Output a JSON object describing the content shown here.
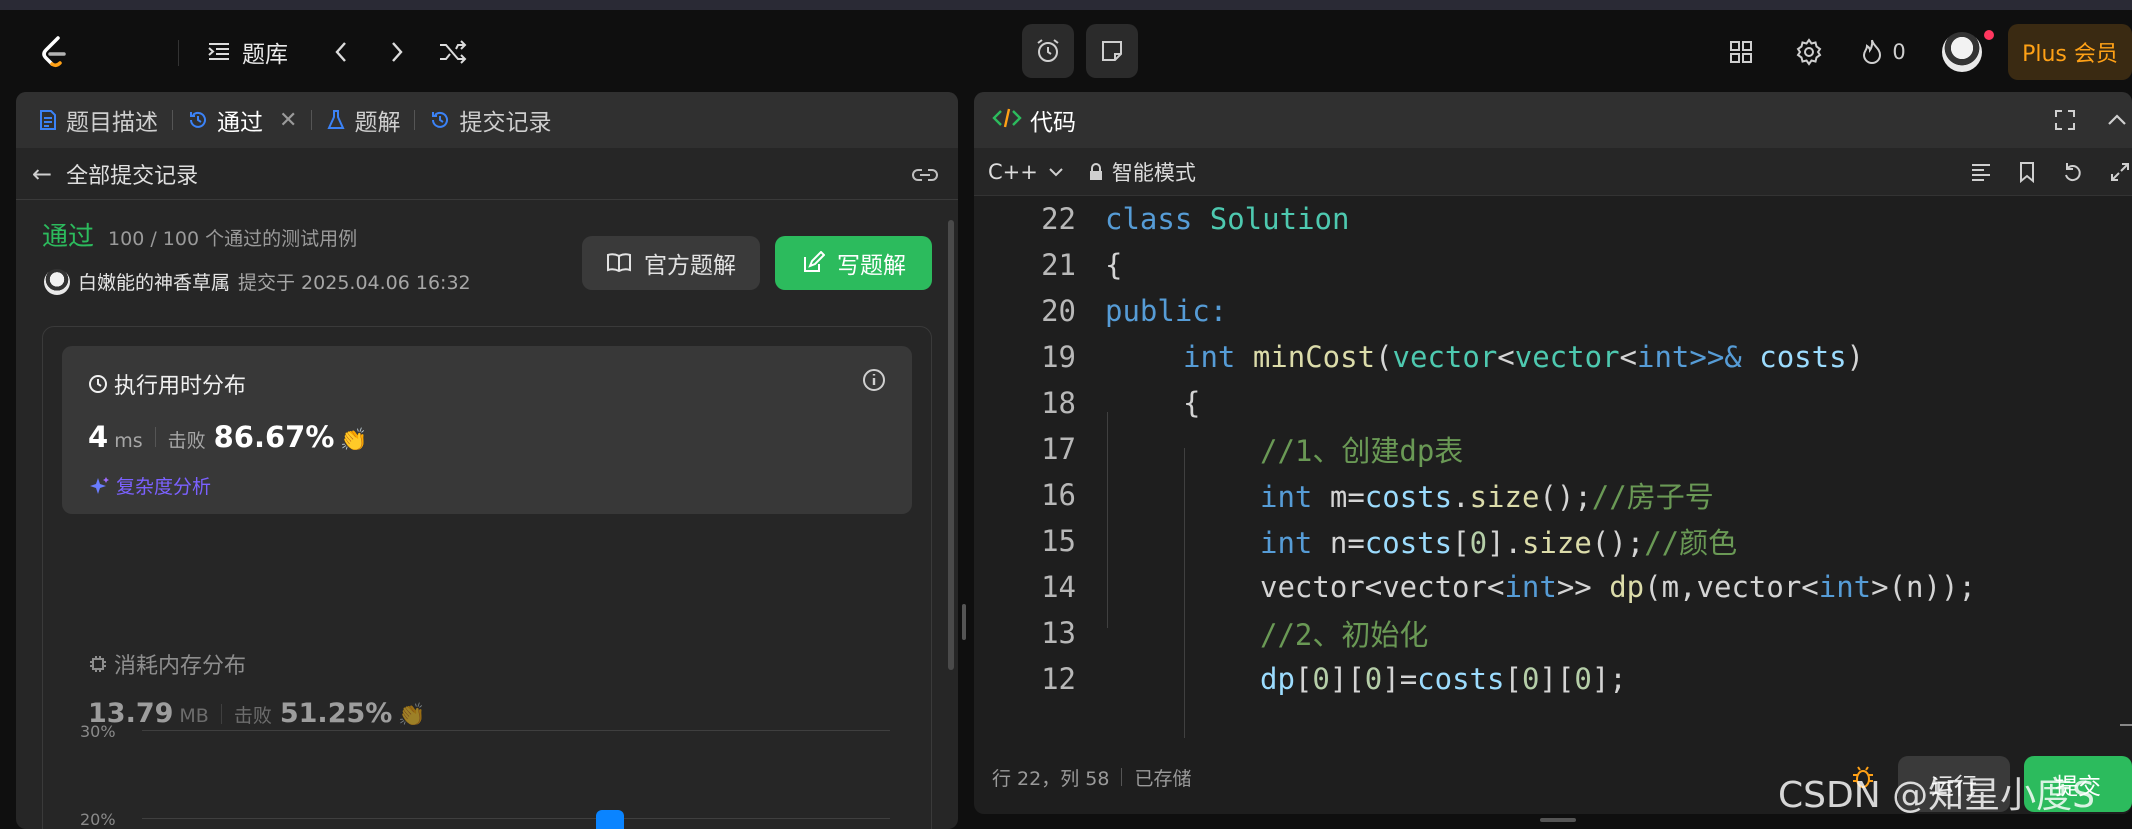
{
  "topbar": {
    "problem_list": "题库",
    "plus": "Plus 会员",
    "streak_count": "0"
  },
  "left": {
    "tabs": [
      {
        "label": "题目描述"
      },
      {
        "label": "通过"
      },
      {
        "label": "题解"
      },
      {
        "label": "提交记录"
      }
    ],
    "back_title": "全部提交记录",
    "status": "通过",
    "tests": "100 / 100 个通过的测试用例",
    "author": "白嫩能的神香草属",
    "submitted_at": "提交于 2025.04.06 16:32",
    "official_solution": "官方题解",
    "write_solution": "写题解",
    "runtime": {
      "title": "执行用时分布",
      "value": "4",
      "unit": "ms",
      "beats_label": "击败",
      "beats": "86.67%",
      "complexity": "复杂度分析"
    },
    "memory": {
      "title": "消耗内存分布",
      "value": "13.79",
      "unit": "MB",
      "beats_label": "击败",
      "beats": "51.25%"
    },
    "chart": {
      "ticks": [
        "30%",
        "20%"
      ]
    }
  },
  "right": {
    "title": "代码",
    "language": "C++",
    "mode": "智能模式",
    "code": [
      {
        "ln": "22"
      },
      {
        "ln": "21"
      },
      {
        "ln": "20"
      },
      {
        "ln": "19"
      },
      {
        "ln": "18"
      },
      {
        "ln": "17"
      },
      {
        "ln": "16"
      },
      {
        "ln": "15"
      },
      {
        "ln": "14"
      },
      {
        "ln": "13"
      },
      {
        "ln": "12"
      }
    ],
    "code_text": {
      "l22a": "class ",
      "l22b": "Solution",
      "l21": "{",
      "l20": "public:",
      "l19a": "int ",
      "l19b": "minCost",
      "l19c": "(",
      "l19d": "vector",
      "l19e": "<",
      "l19f": "vector",
      "l19g": "<",
      "l19h": "int",
      "l19i": ">>& ",
      "l19j": "costs",
      "l19k": ")",
      "l18": "{",
      "l17": "//1、创建dp表",
      "l16a": "int ",
      "l16b": "m",
      "l16c": "=",
      "l16d": "costs",
      "l16e": ".",
      "l16f": "size",
      "l16g": "();",
      "l16h": "//房子号",
      "l15a": "int ",
      "l15b": "n",
      "l15c": "=",
      "l15d": "costs",
      "l15e": "[",
      "l15f": "0",
      "l15g": "].",
      "l15h": "size",
      "l15i": "();",
      "l15j": "//颜色",
      "l14a": "vector<vector<",
      "l14b": "int",
      "l14c": ">> ",
      "l14d": "dp",
      "l14e": "(m,vector<",
      "l14f": "int",
      "l14g": ">(n));",
      "l13": "//2、初始化",
      "l12a": "dp",
      "l12b": "[",
      "l12c": "0",
      "l12d": "][",
      "l12e": "0",
      "l12f": "]=",
      "l12g": "costs",
      "l12h": "[",
      "l12i": "0",
      "l12j": "][",
      "l12k": "0",
      "l12l": "];"
    },
    "status_pos": "行 22，列 58",
    "status_saved": "已存储",
    "run": "运行",
    "submit": "提交"
  },
  "watermark": "CSDN @知星小度S",
  "colors": {
    "accent_green": "#2cbb5d",
    "plus_orange": "#ffa116",
    "link_blue": "#0a84ff",
    "complexity_purple": "#7b61ff"
  }
}
